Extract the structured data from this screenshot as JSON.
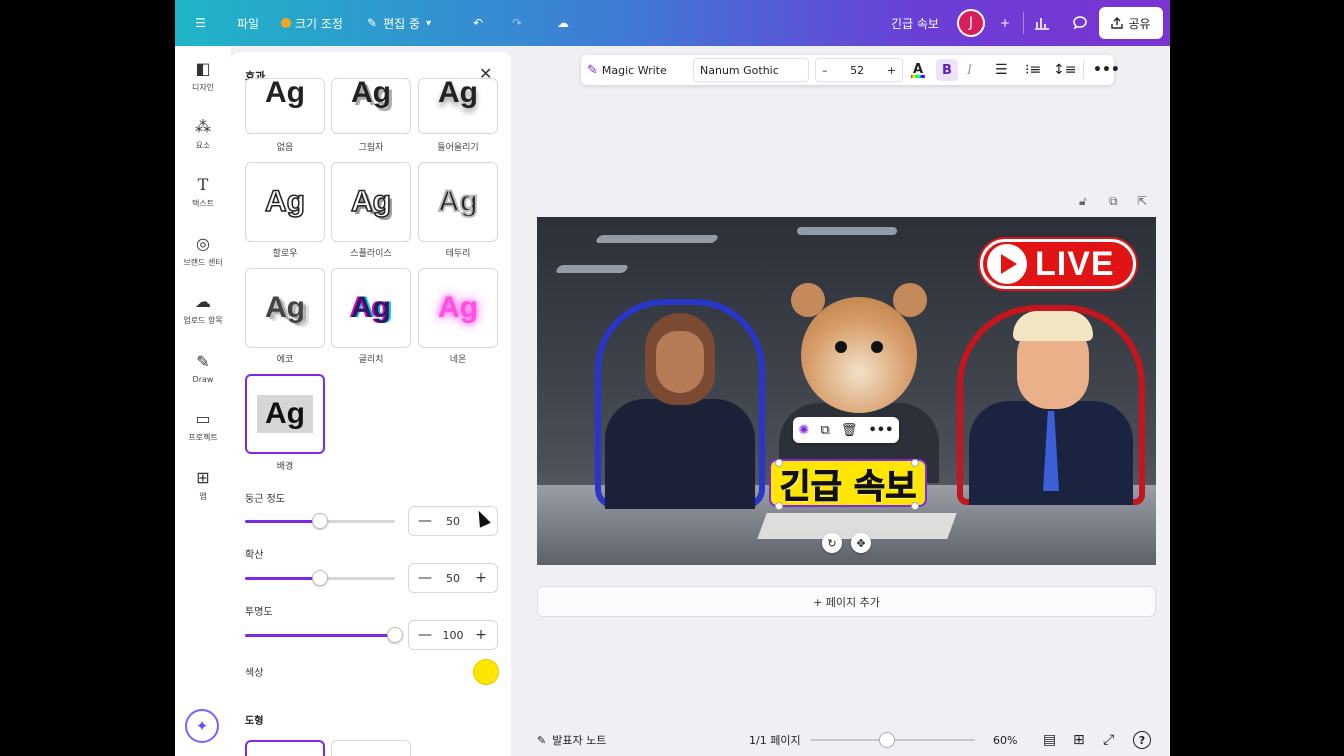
{
  "topbar": {
    "menu_icon": "hamburger-icon",
    "file_label": "파일",
    "resize_label": "크기 조정",
    "edit_label": "편집 중",
    "undo_icon": "undo-icon",
    "redo_icon": "redo-icon",
    "cloud_icon": "cloud-icon",
    "doc_title": "긴급 속보",
    "avatar_initial": "J",
    "share_label": "공유"
  },
  "rail": {
    "items": [
      {
        "label": "디자인",
        "icon": "design-icon"
      },
      {
        "label": "요소",
        "icon": "elements-icon"
      },
      {
        "label": "텍스트",
        "icon": "text-icon"
      },
      {
        "label": "브랜드 센터",
        "icon": "brand-icon"
      },
      {
        "label": "업로드 항목",
        "icon": "upload-icon"
      },
      {
        "label": "Draw",
        "icon": "draw-icon"
      },
      {
        "label": "프로젝트",
        "icon": "folder-icon"
      },
      {
        "label": "앱",
        "icon": "apps-icon"
      }
    ],
    "magic_icon": "magic-sparkle-icon"
  },
  "panel": {
    "title": "효과",
    "styles": [
      {
        "label": "없음",
        "sample": "Ag"
      },
      {
        "label": "그림자",
        "sample": "Ag"
      },
      {
        "label": "들어올리기",
        "sample": "Ag"
      },
      {
        "label": "할로우",
        "sample": "Ag"
      },
      {
        "label": "스플라이스",
        "sample": "Ag"
      },
      {
        "label": "테두리",
        "sample": "Ag"
      },
      {
        "label": "에코",
        "sample": "Ag"
      },
      {
        "label": "글리치",
        "sample": "Ag"
      },
      {
        "label": "네온",
        "sample": "Ag"
      },
      {
        "label": "배경",
        "sample": "Ag",
        "selected": true
      }
    ],
    "roundness": {
      "label": "둥근 정도",
      "value": "50",
      "fraction": 0.5
    },
    "spread": {
      "label": "확산",
      "value": "50",
      "fraction": 0.5
    },
    "transparency": {
      "label": "투명도",
      "value": "100",
      "fraction": 1.0
    },
    "color": {
      "label": "색상",
      "value": "#ffe600"
    },
    "shape_label": "도형"
  },
  "text_toolbar": {
    "magic_write": "Magic Write",
    "font": "Nanum Gothic",
    "size": "52",
    "minus": "–",
    "plus": "+",
    "color_letter": "A",
    "bold": "B",
    "italic": "I"
  },
  "canvas": {
    "live_text": "LIVE",
    "headline": "긴급 속보"
  },
  "add_page_label": "+ 페이지 추가",
  "bottombar": {
    "notes_label": "발표자 노트",
    "pages_label": "1/1 페이지",
    "zoom_label": "60%",
    "zoom_fraction": 0.6
  }
}
